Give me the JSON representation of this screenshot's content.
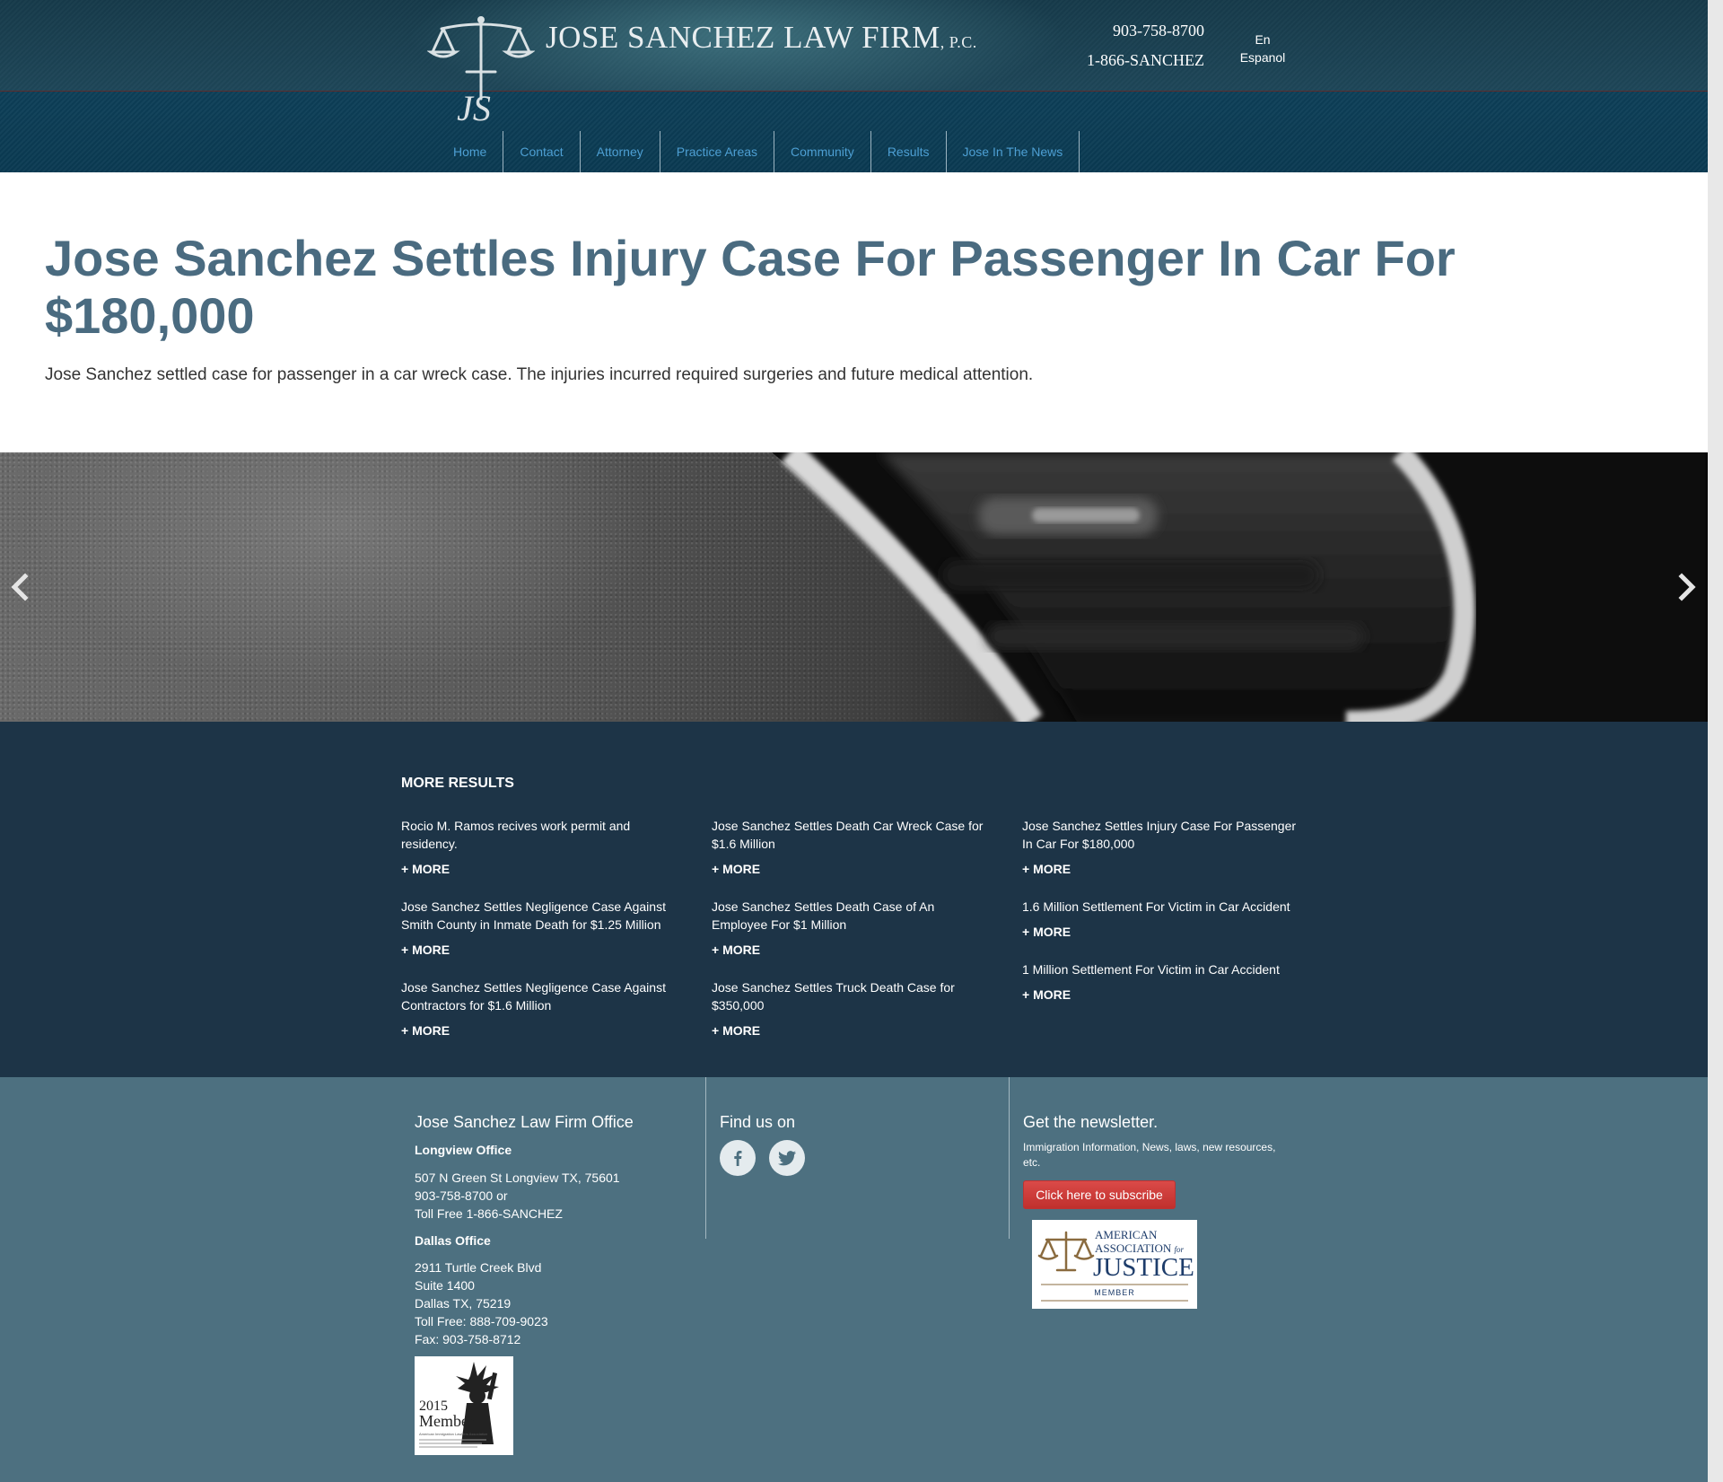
{
  "header": {
    "brand_name": "JOSE SANCHEZ LAW FIRM",
    "brand_suffix": "P.C.",
    "logo_letters": "JS",
    "phone_primary": "903-758-8700",
    "phone_toll_free": "1-866-SANCHEZ",
    "language_links": [
      "En",
      "Espanol"
    ]
  },
  "nav": {
    "items": [
      "Home",
      "Contact",
      "Attorney",
      "Practice Areas",
      "Community",
      "Results",
      "Jose In The News"
    ],
    "link_color": "#4d9fd3"
  },
  "article": {
    "title": "Jose Sanchez Settles Injury Case For Passenger In Car For $180,000",
    "body": "Jose Sanchez settled case for passenger in a car wreck case. The injuries incurred required surgeries and future medical attention."
  },
  "slider": {
    "prev_icon": "chevron-left-icon",
    "next_icon": "chevron-right-icon"
  },
  "more_results": {
    "heading": "MORE RESULTS",
    "more_label": "+ MORE",
    "columns": [
      [
        "Rocio M. Ramos recives work permit and residency.",
        "Jose Sanchez Settles Negligence Case Against Smith County in Inmate Death for $1.25 Million",
        "Jose Sanchez Settles Negligence Case Against Contractors for $1.6 Million"
      ],
      [
        "Jose Sanchez Settles Death Car Wreck Case for $1.6 Million",
        "Jose Sanchez Settles Death Case of An Employee For $1 Million",
        "Jose Sanchez Settles Truck Death Case for $350,000"
      ],
      [
        "Jose Sanchez Settles Injury Case For Passenger In Car For $180,000",
        "1.6 Million Settlement For Victim in Car Accident",
        "1 Million Settlement For Victim in Car Accident"
      ]
    ]
  },
  "footer": {
    "office_heading": "Jose Sanchez Law Firm Office",
    "longview": {
      "title": "Longview Office",
      "lines": [
        "507 N Green St Longview TX, 75601",
        "903-758-8700 or",
        "Toll Free 1-866-SANCHEZ"
      ]
    },
    "dallas": {
      "title": "Dallas Office",
      "lines": [
        "2911 Turtle Creek Blvd",
        "Suite 1400",
        "Dallas TX, 75219",
        "Toll Free: 888-709-9023",
        "Fax: 903-758-8712"
      ]
    },
    "find_us_heading": "Find us on",
    "social": [
      "facebook-icon",
      "twitter-icon"
    ],
    "newsletter_heading": "Get the newsletter.",
    "newsletter_text": "Immigration Information, News, laws, new resources, etc.",
    "subscribe_label": "Click here to subscribe",
    "aaj_badge": {
      "line1": "AMERICAN",
      "line2": "ASSOCIATION",
      "line2_suffix": "for",
      "line3": "JUSTICE",
      "line4": "MEMBER"
    },
    "aila_badge": {
      "year": "2015",
      "label": "Member",
      "org": "American Immigration Lawyers Association"
    }
  },
  "colors": {
    "header_bg": "#1b4153",
    "nav_bg": "#0b3c55",
    "title_color": "#4a6b80",
    "results_bg": "#1d3447",
    "footer_bg": "#4d7080",
    "subscribe_red": "#c93a37"
  }
}
